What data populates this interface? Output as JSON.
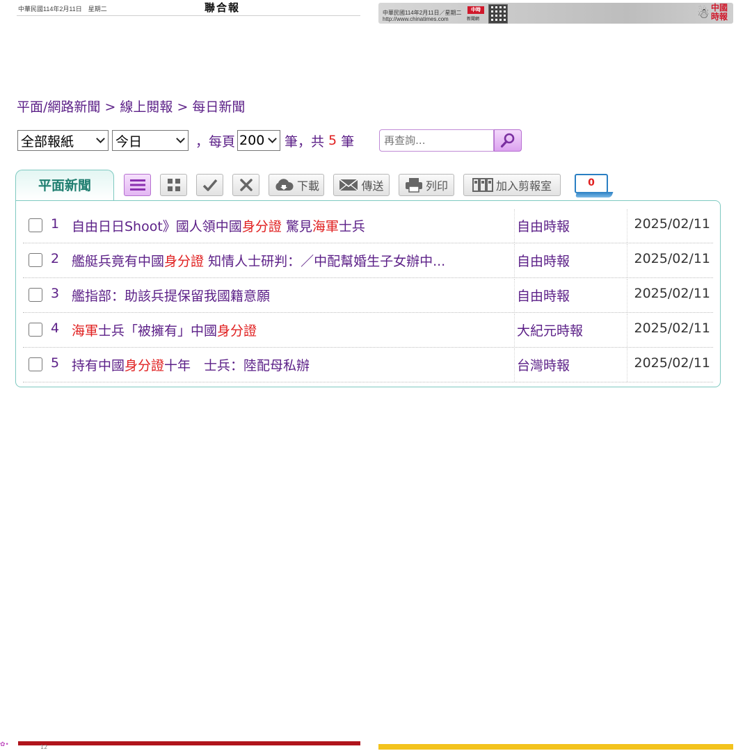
{
  "top_strips": {
    "left_date": "中華民國114年2月11日　星期二",
    "left_masthead": "聯合報",
    "right_line1": "中華民國114年2月11日／星期二",
    "right_line2": "http://www.chinatimes.com",
    "right_badge": "中時",
    "right_badge_sub": "新聞網",
    "right_logo": "中國時報"
  },
  "breadcrumb": {
    "item1": "平面/網路新聞",
    "sep1": " > ",
    "item2": "線上閱報",
    "sep2": " > ",
    "item3": "每日新聞"
  },
  "filters": {
    "paper_selected": "全部報紙",
    "date_selected": "今日",
    "per_page_prefix": "，每頁",
    "per_page_selected": "200",
    "unit": "筆",
    "total_prefix": "，共",
    "total_count": "5",
    "total_unit": "筆",
    "search_placeholder": "再查詢..."
  },
  "tab": {
    "label": "平面新聞"
  },
  "toolbar": {
    "download_label": "下載",
    "send_label": "傳送",
    "print_label": "列印",
    "clip_label": "加入剪報室",
    "clip_count": "0"
  },
  "results": [
    {
      "num": "1",
      "title_parts": [
        {
          "text": "自由日日Shoot》國人領中國",
          "hl": false
        },
        {
          "text": "身分證",
          "hl": true
        },
        {
          "text": " 驚見",
          "hl": false
        },
        {
          "text": "海軍",
          "hl": true
        },
        {
          "text": "士兵",
          "hl": false
        }
      ],
      "source": "自由時報",
      "date": "2025/02/11"
    },
    {
      "num": "2",
      "title_parts": [
        {
          "text": "艦艇兵竟有中國",
          "hl": false
        },
        {
          "text": "身分證",
          "hl": true
        },
        {
          "text": " 知情人士研判：／中配幫婚生子女辦中...",
          "hl": false
        }
      ],
      "source": "自由時報",
      "date": "2025/02/11"
    },
    {
      "num": "3",
      "title_parts": [
        {
          "text": "艦指部：助該兵提保留我國籍意願",
          "hl": false
        }
      ],
      "source": "自由時報",
      "date": "2025/02/11"
    },
    {
      "num": "4",
      "title_parts": [
        {
          "text": "海軍",
          "hl": true
        },
        {
          "text": "士兵「被擁有」中國",
          "hl": false
        },
        {
          "text": "身分證",
          "hl": true
        }
      ],
      "source": "大紀元時報",
      "date": "2025/02/11"
    },
    {
      "num": "5",
      "title_parts": [
        {
          "text": "持有中國",
          "hl": false
        },
        {
          "text": "身分證",
          "hl": true
        },
        {
          "text": "十年　士兵：陸配母私辦",
          "hl": false
        }
      ],
      "source": "台灣時報",
      "date": "2025/02/11"
    }
  ],
  "bottom": {
    "page_number": "12"
  },
  "colors": {
    "text_primary": "#5b1f87",
    "highlight": "#e02020",
    "panel_border": "#7ec9c0",
    "tab_text": "#1e7d6f",
    "search_accent": "#b66fd0"
  },
  "icons": {
    "search": "magnifier-icon",
    "list_view": "list-icon",
    "grid_view": "grid-icon",
    "select_all": "check-icon",
    "clear": "x-icon",
    "download": "cloud-download-icon",
    "send": "envelope-icon",
    "print": "printer-icon",
    "clip": "binders-icon"
  }
}
